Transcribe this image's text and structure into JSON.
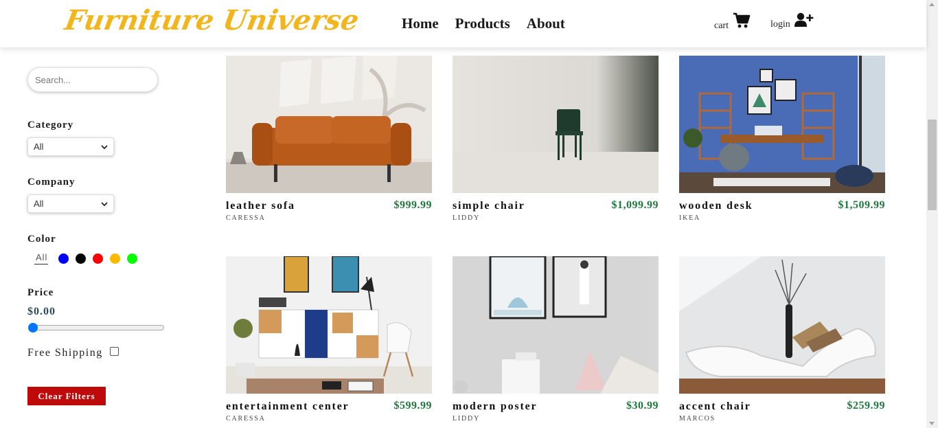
{
  "header": {
    "logo": "Furniture Universe",
    "nav": [
      "Home",
      "Products",
      "About"
    ],
    "cart_label": "cart",
    "login_label": "login"
  },
  "filters": {
    "search_placeholder": "Search...",
    "category_label": "Category",
    "category_value": "All",
    "company_label": "Company",
    "company_value": "All",
    "color_label": "Color",
    "color_all": "All",
    "colors": [
      "#0000ff",
      "#000000",
      "#ff0000",
      "#ffb900",
      "#00ff00"
    ],
    "price_label": "Price",
    "price_value": "$0.00",
    "price_slider_fraction": 0,
    "shipping_label": "Free Shipping",
    "free_shipping_checked": false,
    "clear_label": "Clear Filters"
  },
  "products": [
    {
      "name": "leather sofa",
      "price": "$999.99",
      "company": "caressa"
    },
    {
      "name": "simple chair",
      "price": "$1,099.99",
      "company": "liddy"
    },
    {
      "name": "wooden desk",
      "price": "$1,509.99",
      "company": "ikea"
    },
    {
      "name": "entertainment center",
      "price": "$599.99",
      "company": "caressa"
    },
    {
      "name": "modern poster",
      "price": "$30.99",
      "company": "liddy"
    },
    {
      "name": "accent chair",
      "price": "$259.99",
      "company": "marcos"
    }
  ],
  "colors": {
    "brand": "#f3b51c",
    "price": "#1e7a3d",
    "clear_button": "#bf0a0a"
  }
}
